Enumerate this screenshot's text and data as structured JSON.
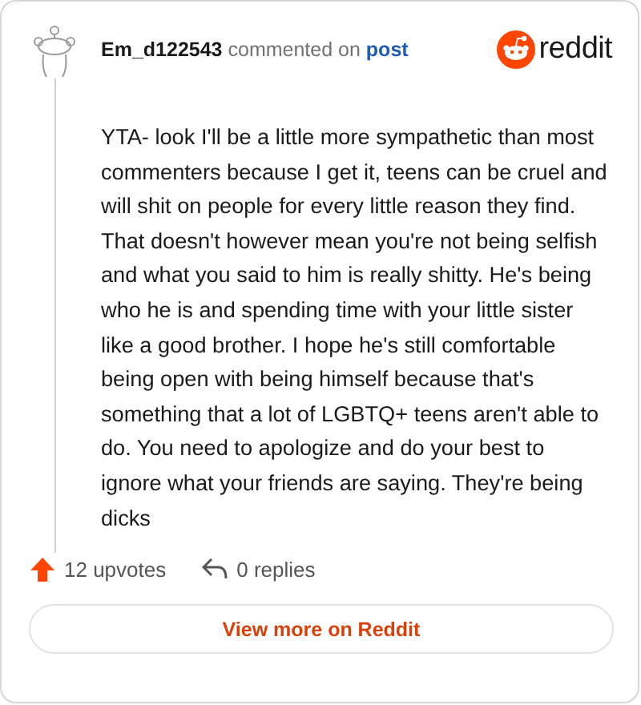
{
  "comment": {
    "author": "Em_d122543",
    "action": "commented on",
    "link": "post",
    "brand": "reddit",
    "body": "YTA- look I'll be a little more sympathetic than most commenters because I get it, teens can be cruel and will shit on people for every little reason they find. That doesn't however mean you're not being selfish and what you said to him is really shitty. He's being who he is and spending time with your little sister like a good brother. I hope he's still comfortable being open with being himself because that's something that a lot of LGBTQ+ teens aren't able to do. You need to apologize and do your best to ignore what your friends are saying. They're being dicks",
    "upvotes": "12 upvotes",
    "replies": "0 replies"
  },
  "button": "View more on Reddit"
}
